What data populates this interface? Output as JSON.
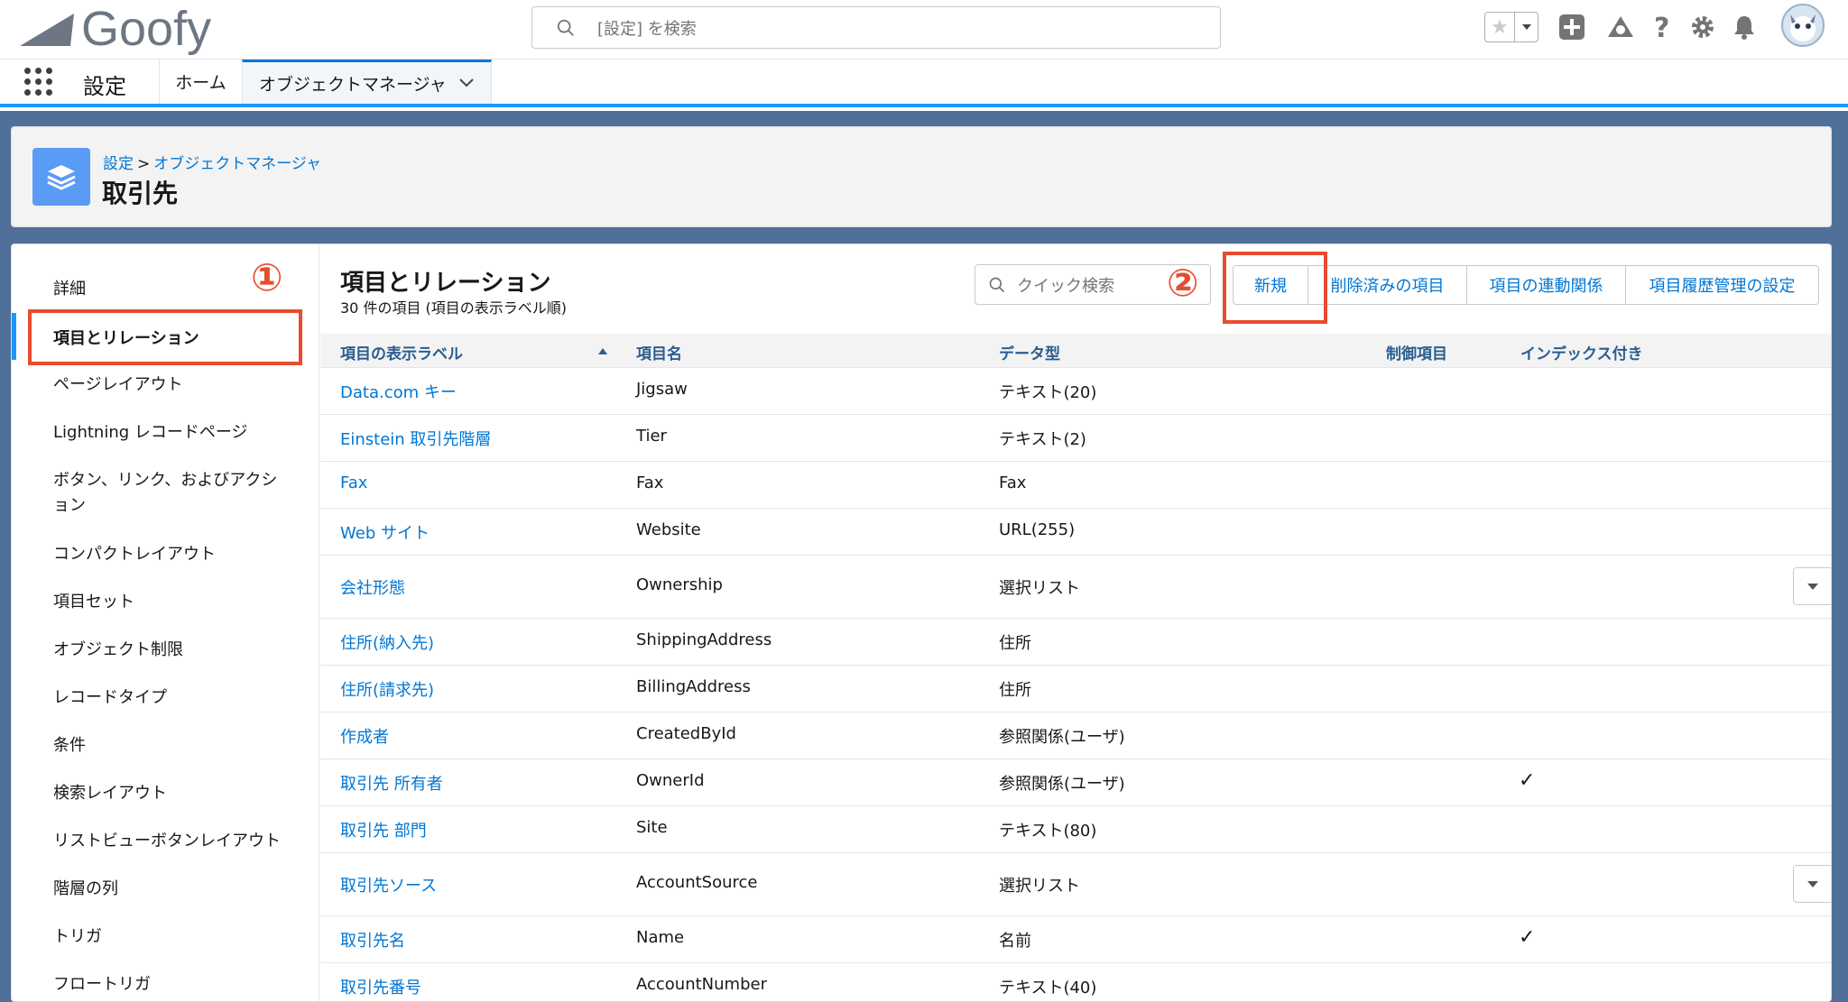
{
  "header": {
    "logo_text": "Goofy",
    "search_placeholder": "[設定] を検索"
  },
  "context_bar": {
    "app_name": "設定",
    "nav": [
      {
        "label": "ホーム"
      },
      {
        "label": "オブジェクトマネージャ"
      }
    ]
  },
  "page_header": {
    "breadcrumb": [
      "設定",
      "オブジェクトマネージャ"
    ],
    "breadcrumb_sep": ">",
    "title": "取引先"
  },
  "sidebar": {
    "items": [
      {
        "label": "詳細"
      },
      {
        "label": "項目とリレーション"
      },
      {
        "label": "ページレイアウト"
      },
      {
        "label": "Lightning レコードページ"
      },
      {
        "label": "ボタン、リンク、およびアクション"
      },
      {
        "label": "コンパクトレイアウト"
      },
      {
        "label": "項目セット"
      },
      {
        "label": "オブジェクト制限"
      },
      {
        "label": "レコードタイプ"
      },
      {
        "label": "条件"
      },
      {
        "label": "検索レイアウト"
      },
      {
        "label": "リストビューボタンレイアウト"
      },
      {
        "label": "階層の列"
      },
      {
        "label": "トリガ"
      },
      {
        "label": "フロートリガ"
      }
    ]
  },
  "annotations": {
    "one": "①",
    "two": "②"
  },
  "section": {
    "title": "項目とリレーション",
    "count_text": "30 件の項目 (項目の表示ラベル順)",
    "quick_search_placeholder": "クイック検索",
    "buttons": [
      "新規",
      "削除済みの項目",
      "項目の連動関係",
      "項目履歴管理の設定"
    ]
  },
  "table": {
    "columns": [
      "項目の表示ラベル",
      "項目名",
      "データ型",
      "制御項目",
      "インデックス付き"
    ],
    "rows": [
      {
        "label": "Data.com キー",
        "name": "Jigsaw",
        "type": "テキスト(20)",
        "controlling": "",
        "indexed": false
      },
      {
        "label": "Einstein 取引先階層",
        "name": "Tier",
        "type": "テキスト(2)",
        "controlling": "",
        "indexed": false
      },
      {
        "label": "Fax",
        "name": "Fax",
        "type": "Fax",
        "controlling": "",
        "indexed": false
      },
      {
        "label": "Web サイト",
        "name": "Website",
        "type": "URL(255)",
        "controlling": "",
        "indexed": false
      },
      {
        "label": "会社形態",
        "name": "Ownership",
        "type": "選択リスト",
        "controlling": "",
        "indexed": false
      },
      {
        "label": "住所(納入先)",
        "name": "ShippingAddress",
        "type": "住所",
        "controlling": "",
        "indexed": false
      },
      {
        "label": "住所(請求先)",
        "name": "BillingAddress",
        "type": "住所",
        "controlling": "",
        "indexed": false
      },
      {
        "label": "作成者",
        "name": "CreatedById",
        "type": "参照関係(ユーザ)",
        "controlling": "",
        "indexed": false
      },
      {
        "label": "取引先 所有者",
        "name": "OwnerId",
        "type": "参照関係(ユーザ)",
        "controlling": "",
        "indexed": true
      },
      {
        "label": "取引先 部門",
        "name": "Site",
        "type": "テキスト(80)",
        "controlling": "",
        "indexed": false
      },
      {
        "label": "取引先ソース",
        "name": "AccountSource",
        "type": "選択リスト",
        "controlling": "",
        "indexed": false
      },
      {
        "label": "取引先名",
        "name": "Name",
        "type": "名前",
        "controlling": "",
        "indexed": true
      },
      {
        "label": "取引先番号",
        "name": "AccountNumber",
        "type": "テキスト(40)",
        "controlling": "",
        "indexed": false
      }
    ]
  },
  "colors": {
    "link": "#0176d3",
    "annotation_red": "#e74c2e",
    "page_bg": "#50709a",
    "brand_blue": "#1b96ff"
  }
}
